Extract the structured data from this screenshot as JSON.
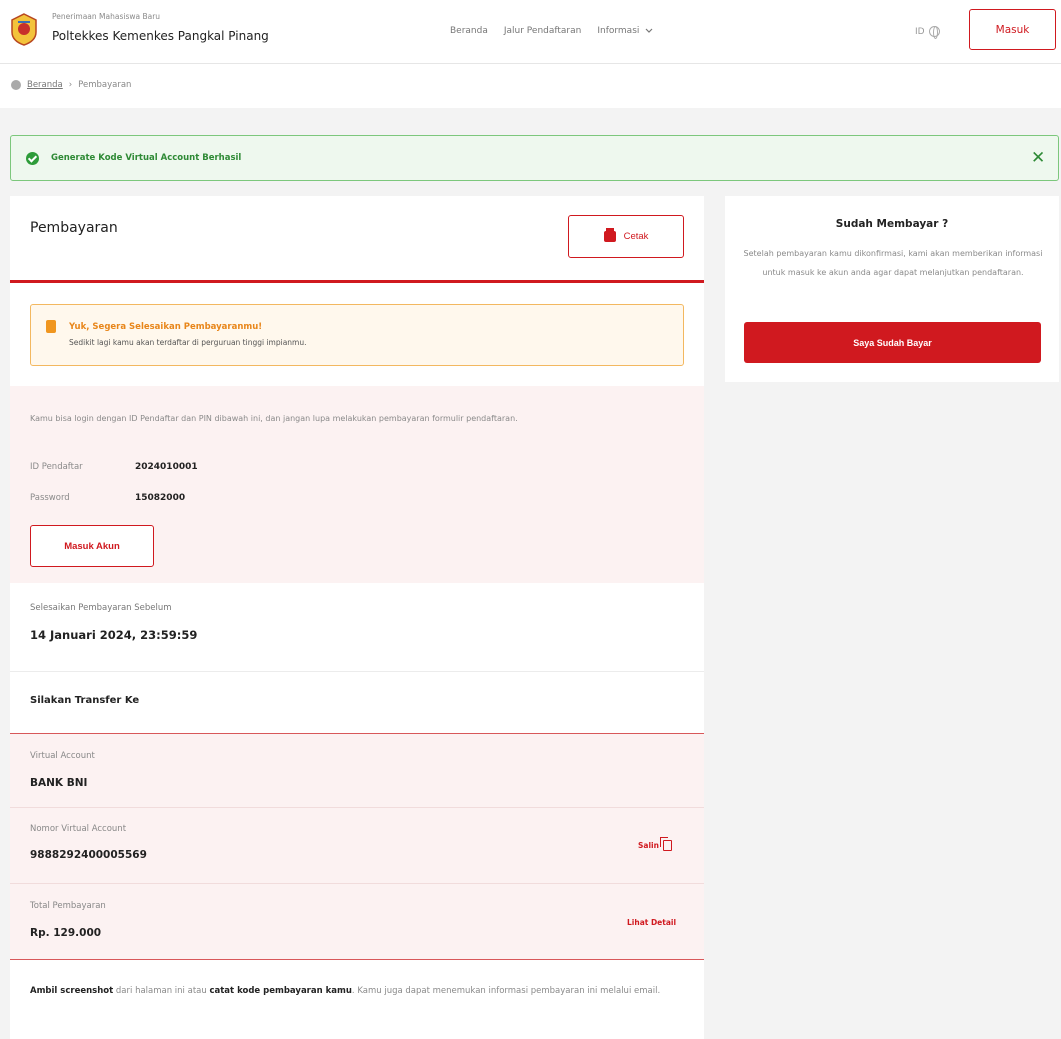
{
  "header": {
    "brand_sub": "Penerimaan Mahasiswa Baru",
    "brand_title": "Poltekkes Kemenkes Pangkal Pinang",
    "nav": [
      "Beranda",
      "Jalur Pendaftaran",
      "Informasi"
    ],
    "lang": "ID",
    "login_label": "Masuk"
  },
  "breadcrumb": {
    "home": "Beranda",
    "separator": "›",
    "current": "Pembayaran"
  },
  "alert": {
    "text": "Generate Kode Virtual Account Berhasil",
    "close": "✕"
  },
  "payment": {
    "title": "Pembayaran",
    "print_label": "Cetak",
    "warning_title": "Yuk, Segera Selesaikan Pembayaranmu!",
    "warning_text": "Sedikit lagi kamu akan terdaftar di perguruan tinggi impianmu.",
    "login_note": "Kamu bisa login dengan ID Pendaftar dan PIN dibawah ini, dan jangan lupa melakukan pembayaran formulir pendaftaran.",
    "id_label": "ID Pendaftar",
    "id_value": "2024010001",
    "password_label": "Password",
    "password_value": "15082000",
    "login_button": "Masuk Akun",
    "deadline_label": "Selesaikan Pembayaran Sebelum",
    "deadline_value": "14 Januari 2024, 23:59:59",
    "transfer_title": "Silakan Transfer Ke",
    "va_label": "Virtual Account",
    "va_bank": "BANK BNI",
    "va_number_label": "Nomor Virtual Account",
    "va_number": "9888292400005569",
    "copy_label": "Salin",
    "total_label": "Total Pembayaran",
    "total_value": "Rp. 129.000",
    "detail_label": "Lihat Detail",
    "foot_1": "Ambil screenshot",
    "foot_2": " dari halaman ini atau ",
    "foot_3": "catat kode pembayaran kamu",
    "foot_4": ". Kamu juga dapat menemukan informasi pembayaran ini melalui email."
  },
  "side": {
    "title": "Sudah Membayar ?",
    "text": "Setelah pembayaran kamu dikonfirmasi, kami akan memberikan informasi untuk masuk ke akun anda agar dapat melanjutkan pendaftaran.",
    "button": "Saya Sudah Bayar"
  },
  "colors": {
    "accent": "#d0191f",
    "success": "#2e9c3a",
    "warning": "#f0961f"
  }
}
